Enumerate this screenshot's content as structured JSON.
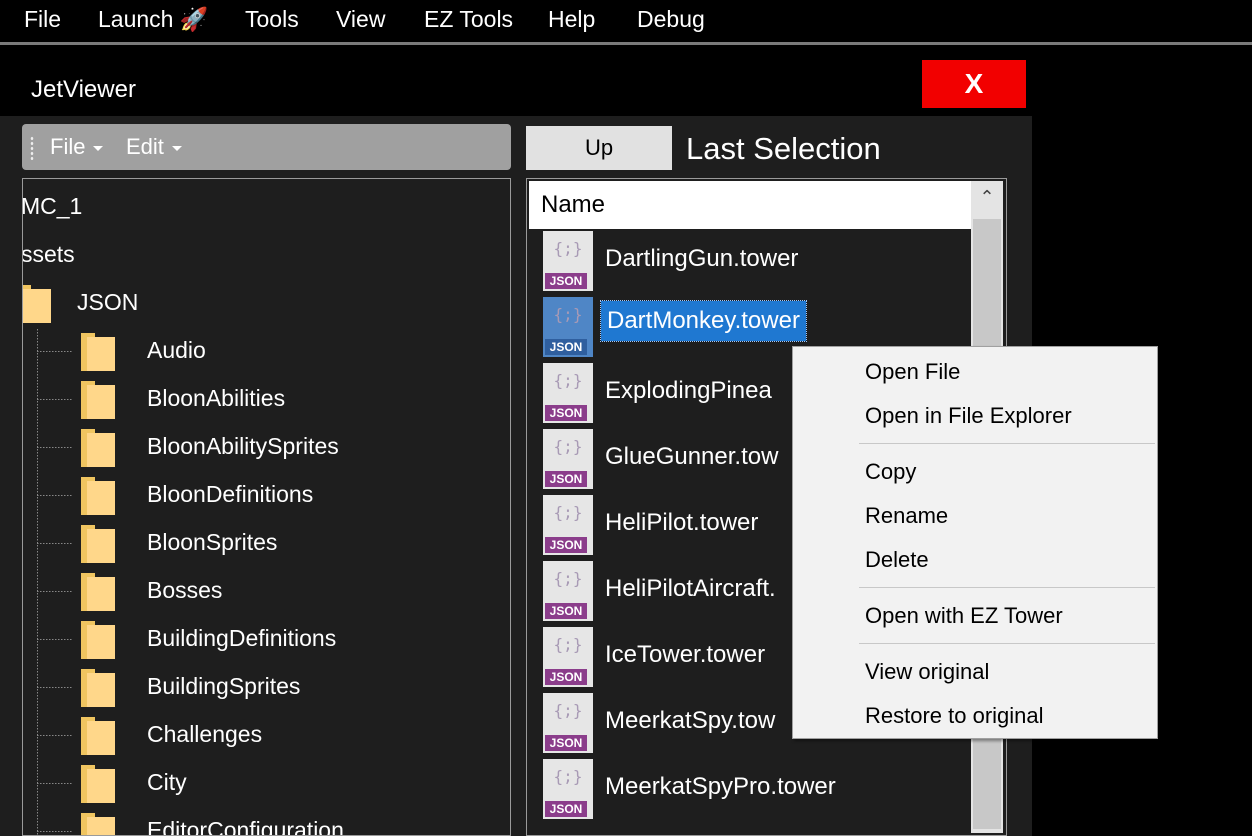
{
  "menubar": {
    "items": [
      "File",
      "Launch 🚀",
      "Tools",
      "View",
      "EZ Tools",
      "Help",
      "Debug"
    ]
  },
  "window": {
    "title": "JetViewer",
    "close_label": "X"
  },
  "toolstrip": {
    "file_label": "File",
    "edit_label": "Edit"
  },
  "navigation": {
    "up_label": "Up",
    "last_selection_label": "Last Selection"
  },
  "tree": {
    "root1": "MC_1",
    "root2": "ssets",
    "json_folder": "JSON",
    "folders": [
      "Audio",
      "BloonAbilities",
      "BloonAbilitySprites",
      "BloonDefinitions",
      "BloonSprites",
      "Bosses",
      "BuildingDefinitions",
      "BuildingSprites",
      "Challenges",
      "City",
      "EditorConfiguration"
    ]
  },
  "filelist": {
    "column_name": "Name",
    "icon_tag": "JSON",
    "icon_braces": "{;}",
    "files": [
      "DartlingGun.tower",
      "DartMonkey.tower",
      "ExplodingPinea",
      "GlueGunner.tow",
      "HeliPilot.tower",
      "HeliPilotAircraft.",
      "IceTower.tower",
      "MeerkatSpy.tow",
      "MeerkatSpyPro.tower"
    ],
    "selected_index": 1
  },
  "context_menu": {
    "open_file": "Open File",
    "open_in_explorer": "Open in File Explorer",
    "copy": "Copy",
    "rename": "Rename",
    "delete": "Delete",
    "open_with_ez_tower": "Open with EZ Tower",
    "view_original": "View original",
    "restore_original": "Restore to original"
  },
  "colors": {
    "close_button": "#f20000",
    "selection": "#1f78d1",
    "json_tag": "#8b3d8b",
    "folder": "#ffd78a"
  }
}
